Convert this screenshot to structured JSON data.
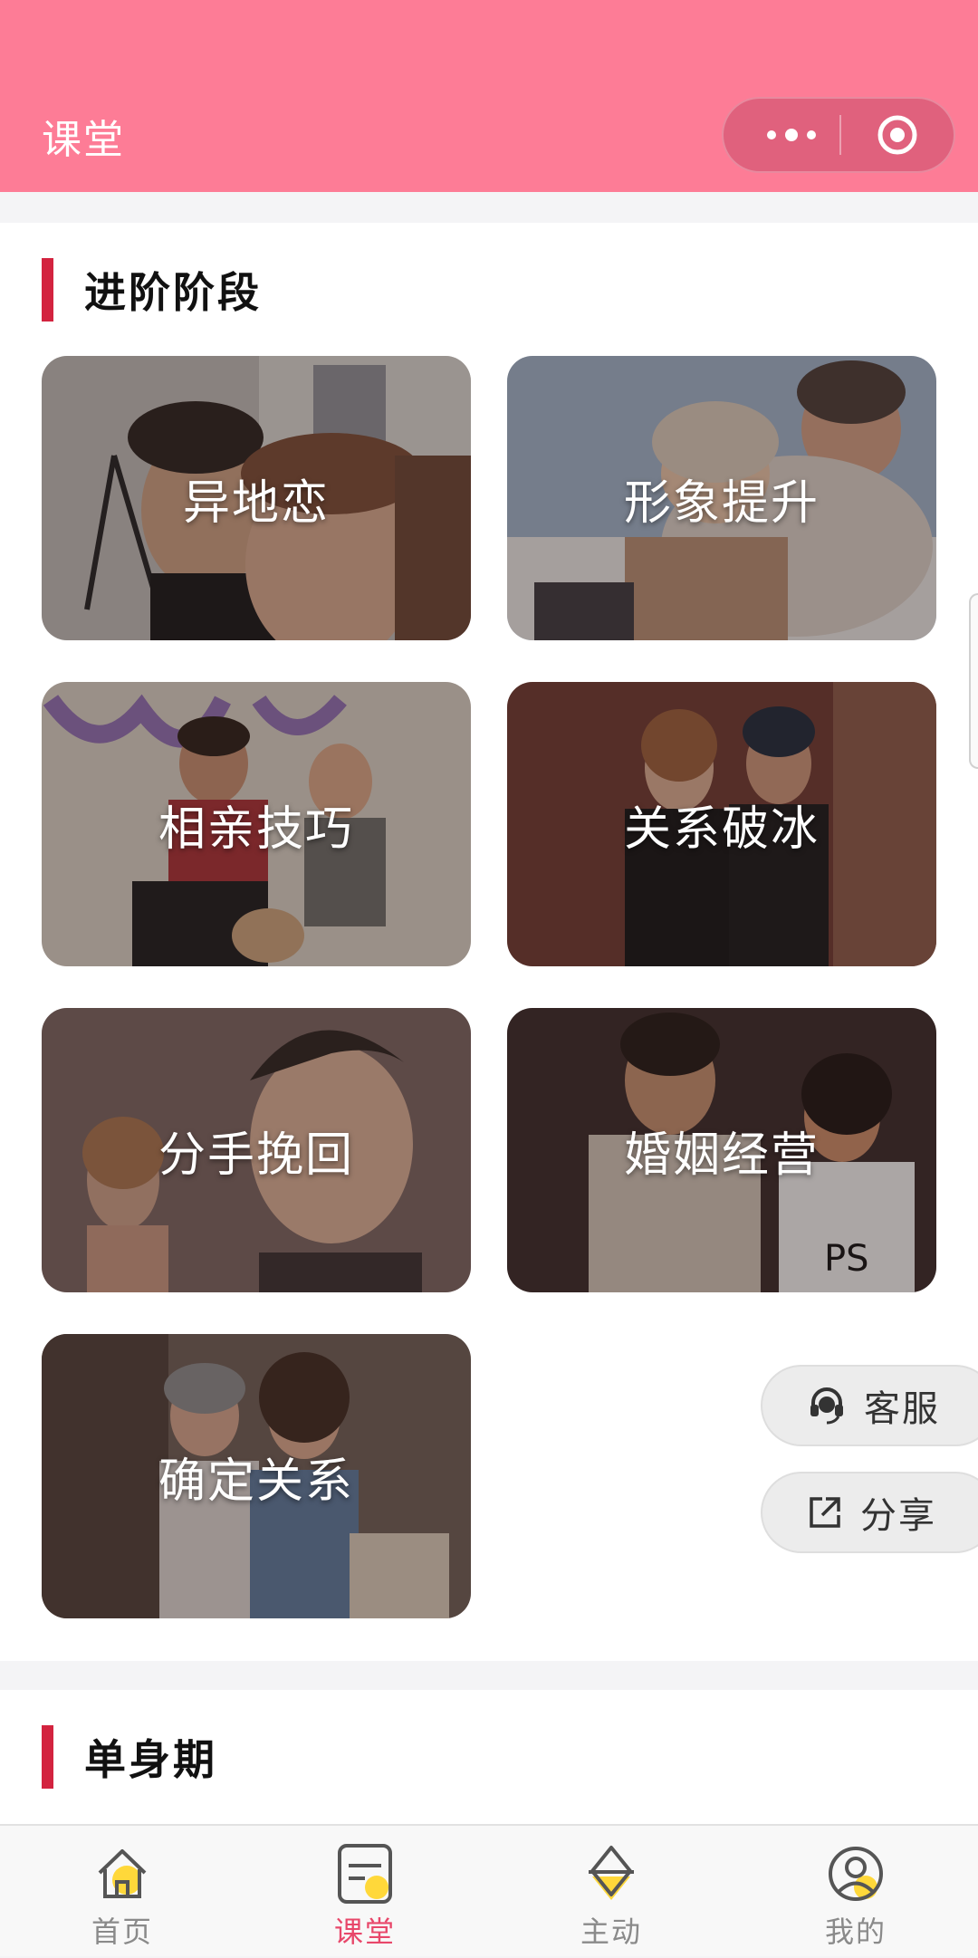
{
  "header": {
    "title": "课堂",
    "more_icon": "more-dots-icon",
    "close_icon": "target-close-icon",
    "background": "#fd7c96"
  },
  "sections": [
    {
      "title": "进阶阶段",
      "cards": [
        {
          "label": "异地恋"
        },
        {
          "label": "形象提升"
        },
        {
          "label": "相亲技巧"
        },
        {
          "label": "关系破冰"
        },
        {
          "label": "分手挽回"
        },
        {
          "label": "婚姻经营"
        },
        {
          "label": "确定关系"
        }
      ]
    },
    {
      "title": "单身期"
    }
  ],
  "floating": {
    "service_label": "客服",
    "share_label": "分享"
  },
  "tabbar": {
    "items": [
      {
        "label": "首页",
        "icon": "home-icon"
      },
      {
        "label": "课堂",
        "icon": "classroom-icon",
        "active": true
      },
      {
        "label": "主动",
        "icon": "diamond-icon"
      },
      {
        "label": "我的",
        "icon": "user-icon"
      }
    ],
    "active_color": "#e8476a",
    "accent": "#ffd83a"
  }
}
